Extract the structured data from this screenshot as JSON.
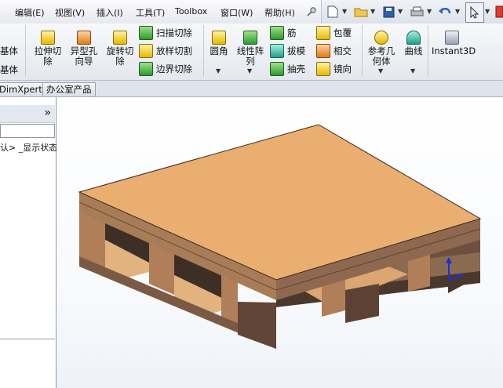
{
  "menubar": {
    "items": [
      "编辑(E)",
      "视图(V)",
      "插入(I)",
      "工具(T)",
      "Toolbox",
      "窗口(W)",
      "帮助(H)"
    ]
  },
  "quick_access": {
    "icons": [
      "pin-icon",
      "new-document-icon",
      "open-folder-icon",
      "save-icon",
      "print-icon",
      "undo-icon",
      "select-cursor-icon",
      "options-icon"
    ]
  },
  "ribbon": {
    "left_partial": [
      "基体",
      "基体"
    ],
    "large_buttons": [
      {
        "label": "拉伸切\n除"
      },
      {
        "label": "异型孔\n向导"
      },
      {
        "label": "旋转切\n除"
      }
    ],
    "cut_group": [
      "扫描切除",
      "放样切割",
      "边界切除"
    ],
    "fillet": {
      "label": "圆角"
    },
    "linear_pattern": {
      "label": "线性阵\n列"
    },
    "feature_group_1": [
      "筋",
      "拔模",
      "抽壳"
    ],
    "feature_group_2": [
      "包覆",
      "相交",
      "镜向"
    ],
    "ref_geometry": {
      "label": "参考几\n何体"
    },
    "curves": {
      "label": "曲线"
    },
    "instant3d": {
      "label": "Instant3D"
    }
  },
  "tabs": [
    "DimXpert",
    "办公室产品"
  ],
  "left_panel": {
    "collapse_glyph": "»",
    "tree_text": "认> _显示状态"
  },
  "colors": {
    "pallet_top": "#e8ad6f",
    "pallet_front": "#a77b56",
    "pallet_side": "#7a5a42",
    "pallet_dark": "#3c2d24",
    "triad_blue": "#1b2fd8"
  }
}
